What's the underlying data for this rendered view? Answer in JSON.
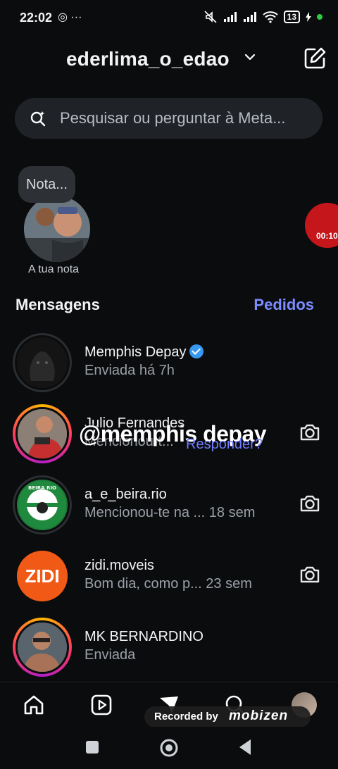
{
  "status_bar": {
    "time": "22:02",
    "left_icons": "◎ ···",
    "battery": "13"
  },
  "header": {
    "account_name": "ederlima_o_edao"
  },
  "search": {
    "placeholder": "Pesquisar ou perguntar à Meta..."
  },
  "notes": {
    "bubble": "Nota...",
    "caption": "A tua nota",
    "live_time": "00:10"
  },
  "section": {
    "title": "Mensagens",
    "requests": "Pedidos"
  },
  "threads": [
    {
      "name": "Memphis Depay",
      "verified": true,
      "subtitle": "Enviada há 7h",
      "has_camera": false
    },
    {
      "name": "Julio Fernandes",
      "subtitle": "Mencionou-t...",
      "has_camera": true
    },
    {
      "name": "a_e_beira.rio",
      "subtitle": "Mencionou-te na ...  18 sem",
      "has_camera": true
    },
    {
      "name": "zidi.moveis",
      "subtitle": "Bom dia, como p...  23 sem",
      "has_camera": true
    },
    {
      "name": "MK BERNARDINO",
      "subtitle": "Enviada",
      "has_camera": false
    }
  ],
  "overlay": {
    "text": "@memphis depay",
    "reply": "Responder?"
  },
  "avatar_labels": {
    "beira": "BEIRA RIO",
    "zidi": "ZIDI"
  },
  "recorder": {
    "label": "Recorded by",
    "brand": "mobizen"
  },
  "colors": {
    "background": "#0b0c0e",
    "accent": "#7c8cff",
    "verified": "#3897f0"
  }
}
